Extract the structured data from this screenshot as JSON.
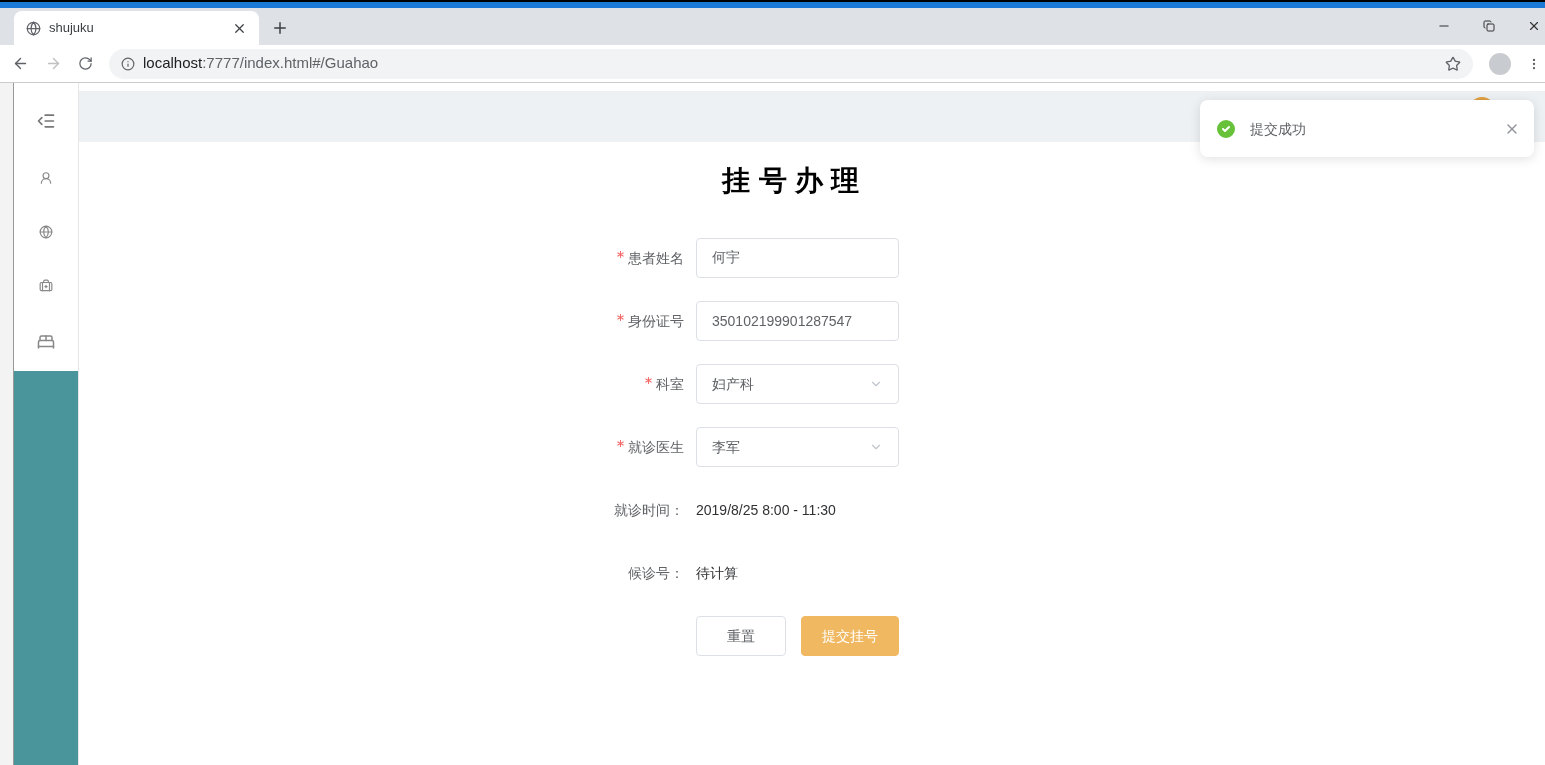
{
  "browser": {
    "tab_title": "shujuku",
    "url": {
      "host": "localhost",
      "path": ":7777/index.html#/Guahao"
    }
  },
  "page": {
    "title": "挂号办理",
    "fields": [
      {
        "kind": "input",
        "label": "患者姓名",
        "required": true,
        "value": "何宇"
      },
      {
        "kind": "input",
        "label": "身份证号",
        "required": true,
        "value": "350102199901287547"
      },
      {
        "kind": "select",
        "label": "科室",
        "required": true,
        "value": "妇产科"
      },
      {
        "kind": "select",
        "label": "就诊医生",
        "required": true,
        "value": "李军"
      },
      {
        "kind": "text",
        "label": "就诊时间：",
        "required": false,
        "value": "2019/8/25 8:00 - 11:30"
      },
      {
        "kind": "text",
        "label": "候诊号：",
        "required": false,
        "value": "待计算"
      }
    ],
    "buttons": [
      {
        "kind": "default",
        "label": "重置"
      },
      {
        "kind": "primary",
        "label": "提交挂号"
      }
    ]
  },
  "toast": {
    "message": "提交成功"
  }
}
